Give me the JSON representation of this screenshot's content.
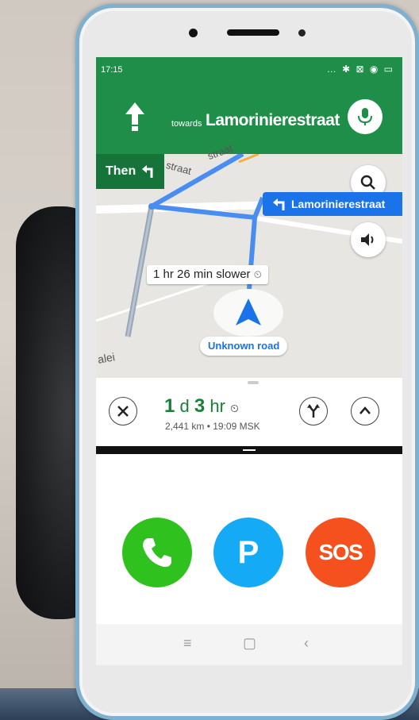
{
  "status_bar": {
    "time": "17:15",
    "icons": "… ✱ ⊠ ◉ ▭"
  },
  "navigation": {
    "towards_prefix": "towards",
    "street_name": "Lamorinierestraat",
    "then_label": "Then"
  },
  "map": {
    "turn_callout": "Lamorinierestraat",
    "delay_label": "1 hr 26 min slower",
    "current_road": "Unknown road",
    "street_fragment_1": "straat",
    "street_fragment_2": "straat",
    "street_fragment_3": "alei"
  },
  "trip": {
    "eta_days": "1",
    "eta_days_unit": "d",
    "eta_hours": "3",
    "eta_hours_unit": "hr",
    "distance_time": "2,441 km • 19:09 MSK"
  },
  "quick_actions": {
    "parking_label": "P",
    "sos_label": "SOS"
  },
  "colors": {
    "nav_green": "#1e8e48",
    "dark_green": "#16733a",
    "route_blue": "#1a73e8",
    "eta_green": "#188038",
    "call_green": "#2fc21e",
    "parking_blue": "#14aaf5",
    "sos_orange": "#f4511e"
  },
  "icons": {
    "straight_arrow": "arrow-up-icon",
    "microphone": "microphone-icon",
    "turn_left": "turn-left-icon",
    "search": "search-icon",
    "volume": "volume-icon",
    "close": "close-icon",
    "alternates": "route-fork-icon",
    "expand": "chevron-up-icon",
    "phone": "phone-icon"
  }
}
